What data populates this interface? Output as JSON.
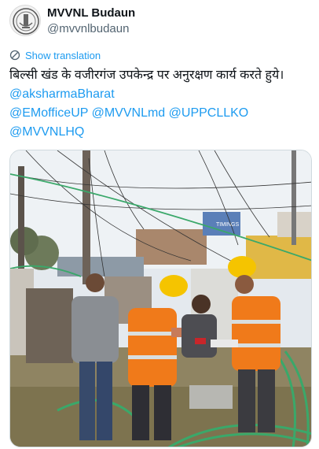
{
  "author": {
    "display_name": "MVVNL Budaun",
    "handle": "@mvvnlbudaun",
    "avatar_icon": "emblem-logo"
  },
  "translate": {
    "label": "Show translation",
    "icon": "translate-icon"
  },
  "tweet": {
    "text": "बिल्सी खंड के वजीरगंज उपकेन्द्र पर अनुरक्षण कार्य करते हुये।",
    "mentions_line1": [
      "@aksharmaBharat"
    ],
    "mentions_line2": [
      "@EMofficeUP",
      "@MVVNLmd",
      "@UPPCLLKO"
    ],
    "mentions_line3": [
      "@MVVNLHQ"
    ]
  },
  "media": {
    "billboard_text": "TIMINGS",
    "colors": {
      "sky": "#e9eef2",
      "safety_vest": "#f07a1a",
      "helmet": "#f5c400",
      "cable": "#3aa86a"
    }
  }
}
